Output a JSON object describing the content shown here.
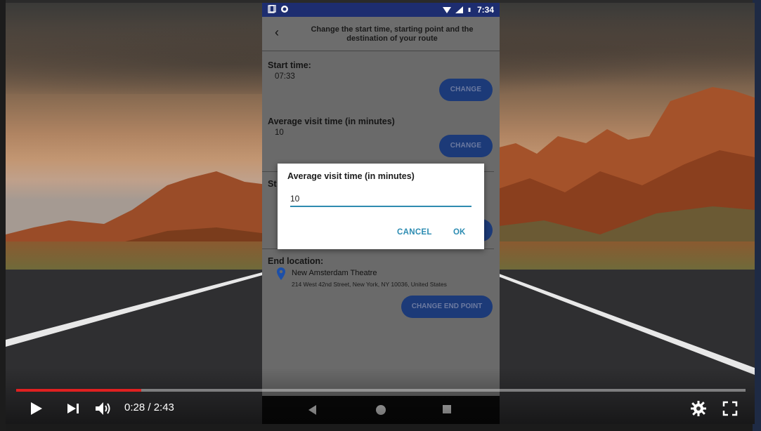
{
  "phone": {
    "status_time": "7:34",
    "header_title": "Change the start time, starting point and the destination of your route",
    "start_time_label": "Start time:",
    "start_time_value": "07:33",
    "change_label_1": "CHANGE",
    "avg_visit_label": "Average visit time (in minutes)",
    "avg_visit_value": "10",
    "change_label_2": "CHANGE",
    "start_point_label_partial": "St",
    "end_location_label": "End location:",
    "end_location_name": "New Amsterdam Theatre",
    "end_location_address": "214 West 42nd Street,  New York,  NY 10036, United States",
    "change_end_point_label": "CHANGE END POINT"
  },
  "dialog": {
    "title": "Average visit time (in minutes)",
    "input_value": "10",
    "cancel_label": "CANCEL",
    "ok_label": "OK"
  },
  "player": {
    "time_display": "0:28 / 2:43",
    "progress_fraction": 0.1718
  },
  "colors": {
    "status_bar": "#1d2d70",
    "button_blue": "#1c3a78",
    "dialog_accent": "#2c8cb2",
    "progress_red": "#e02020"
  }
}
